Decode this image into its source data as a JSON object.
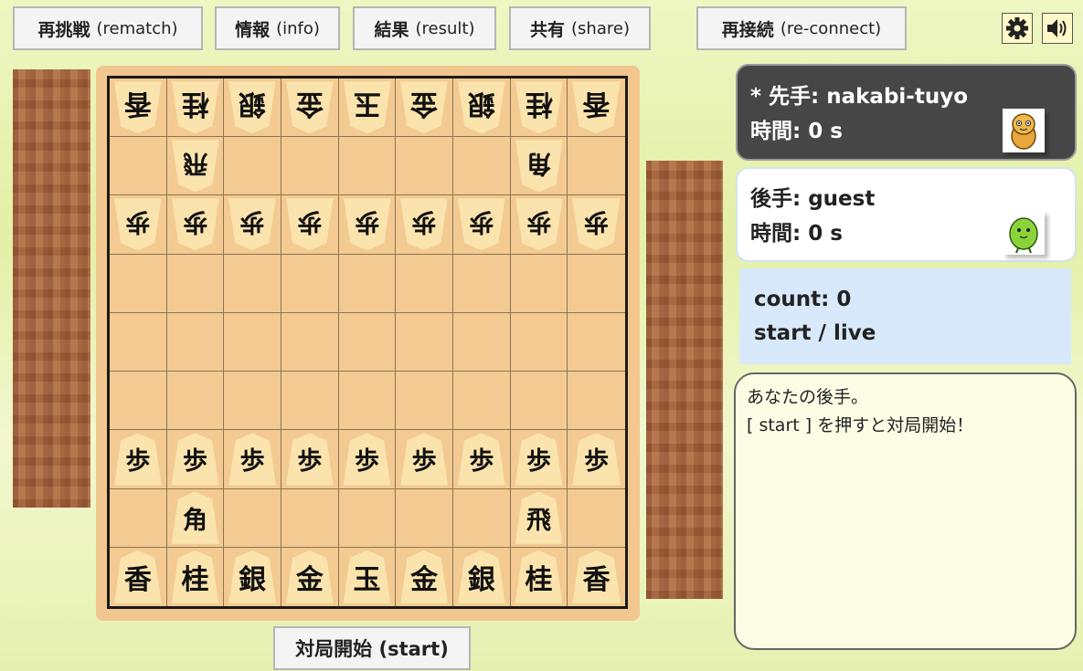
{
  "toolbar": {
    "rematch": {
      "main": "再挑戦",
      "sub": "(rematch)"
    },
    "info": {
      "main": "情報",
      "sub": "(info)"
    },
    "result": {
      "main": "結果",
      "sub": "(result)"
    },
    "share": {
      "main": "共有",
      "sub": "(share)"
    },
    "reconnect": {
      "main": "再接続",
      "sub": "(re-connect)"
    },
    "icons": [
      "gear-icon",
      "speaker-icon"
    ]
  },
  "board": {
    "gote_back_rank": [
      "香",
      "桂",
      "銀",
      "金",
      "玉",
      "金",
      "銀",
      "桂",
      "香"
    ],
    "gote_rook": "飛",
    "gote_bishop": "角",
    "gote_pawn": "歩",
    "sente_pawn": "歩",
    "sente_bishop": "角",
    "sente_rook": "飛",
    "sente_back_rank": [
      "香",
      "桂",
      "銀",
      "金",
      "玉",
      "金",
      "銀",
      "桂",
      "香"
    ]
  },
  "players": {
    "sente": {
      "label": "* 先手: nakabi-tuyo",
      "time": "時間: 0 s",
      "avatar": "orange-character-icon"
    },
    "gote": {
      "label": "後手: guest",
      "time": "時間: 0 s",
      "avatar": "green-blob-character-icon"
    }
  },
  "status": {
    "count": "count: 0",
    "state": "start / live"
  },
  "log": {
    "line1": "あなたの後手。",
    "line2": "[ start ] を押すと対局開始！"
  },
  "start_button": "対局開始 (start)",
  "colors": {
    "board": "#f2ca92",
    "piece": "#fbe3ad",
    "stand": "#a8653e",
    "sente_panel": "#464646",
    "status_panel": "#d7e9fa",
    "log_panel": "#fdfde6"
  }
}
